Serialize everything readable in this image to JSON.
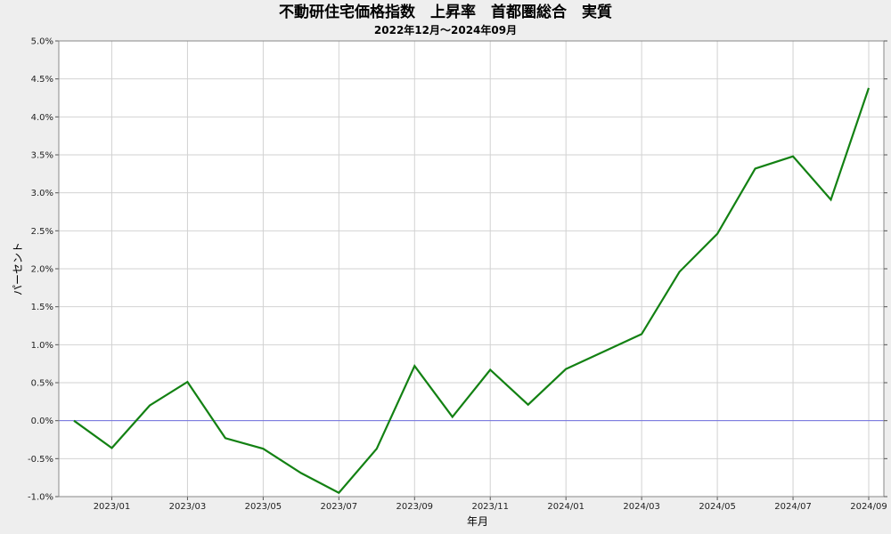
{
  "chart_data": {
    "type": "line",
    "title": "不動研住宅価格指数　上昇率　首都圏総合　実質",
    "subtitle": "2022年12月～2024年09月",
    "xlabel": "年月",
    "ylabel": "パーセント",
    "x": [
      "2022/12",
      "2023/01",
      "2023/02",
      "2023/03",
      "2023/04",
      "2023/05",
      "2023/06",
      "2023/07",
      "2023/08",
      "2023/09",
      "2023/10",
      "2023/11",
      "2023/12",
      "2024/01",
      "2024/02",
      "2024/03",
      "2024/04",
      "2024/05",
      "2024/06",
      "2024/07",
      "2024/08",
      "2024/09"
    ],
    "x_tick_labels": [
      "2023/01",
      "2023/03",
      "2023/05",
      "2023/07",
      "2023/09",
      "2023/11",
      "2024/01",
      "2024/03",
      "2024/05",
      "2024/07",
      "2024/09"
    ],
    "y_tick_labels": [
      "-1.0%",
      "-0.5%",
      "0.0%",
      "0.5%",
      "1.0%",
      "1.5%",
      "2.0%",
      "2.5%",
      "3.0%",
      "3.5%",
      "4.0%",
      "4.5%",
      "5.0%"
    ],
    "ylim": [
      -1.0,
      5.0
    ],
    "series": [
      {
        "values": [
          0.0,
          -0.36,
          0.2,
          0.51,
          -0.23,
          -0.37,
          -0.69,
          -0.95,
          -0.37,
          0.72,
          0.05,
          0.67,
          0.21,
          0.68,
          0.91,
          1.14,
          1.96,
          2.46,
          3.32,
          3.48,
          2.91,
          4.38
        ],
        "color": "#138113"
      }
    ],
    "zero_line_color": "#7070e0",
    "grid": true,
    "background": "#ffffff"
  }
}
